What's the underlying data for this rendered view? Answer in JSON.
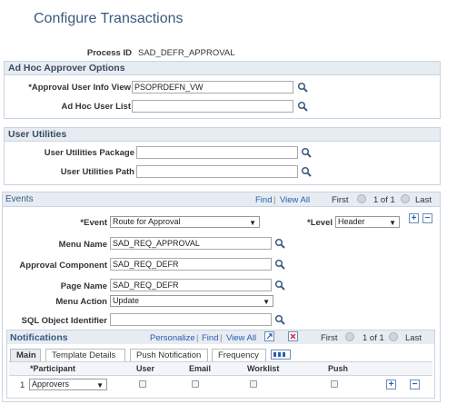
{
  "page_title": "Configure Transactions",
  "process_id": {
    "label": "Process ID",
    "value": "SAD_DEFR_APPROVAL"
  },
  "adhoc": {
    "header": "Ad Hoc Approver Options",
    "approval_user_info_view": {
      "label": "*Approval User Info View",
      "value": "PSOPRDEFN_VW"
    },
    "adhoc_user_list": {
      "label": "Ad Hoc User List",
      "value": ""
    }
  },
  "user_utilities": {
    "header": "User Utilities",
    "package": {
      "label": "User Utilities Package",
      "value": ""
    },
    "path": {
      "label": "User Utilities Path",
      "value": ""
    }
  },
  "events": {
    "header": "Events",
    "nav": {
      "find": "Find",
      "sep": "|",
      "view_all": "View All",
      "first": "First",
      "count": "1 of 1",
      "last": "Last"
    },
    "event": {
      "label": "*Event",
      "value": "Route for Approval"
    },
    "level": {
      "label": "*Level",
      "value": "Header"
    },
    "menu_name": {
      "label": "Menu Name",
      "value": "SAD_REQ_APPROVAL"
    },
    "approval_component": {
      "label": "Approval Component",
      "value": "SAD_REQ_DEFR"
    },
    "page_name": {
      "label": "Page Name",
      "value": "SAD_REQ_DEFR"
    },
    "menu_action": {
      "label": "Menu Action",
      "value": "Update"
    },
    "sql_object": {
      "label": "SQL Object Identifier",
      "value": ""
    }
  },
  "notifications": {
    "header": "Notifications",
    "nav": {
      "personalize": "Personalize",
      "sep": "|",
      "find": "Find",
      "view_all": "View All",
      "first": "First",
      "count": "1 of 1",
      "last": "Last"
    },
    "tabs": [
      "Main",
      "Template Details",
      "Push Notification",
      "Frequency"
    ],
    "columns": [
      "*Participant",
      "User",
      "Email",
      "Worklist",
      "Push"
    ],
    "row": {
      "num": "1",
      "participant": "Approvers"
    }
  }
}
